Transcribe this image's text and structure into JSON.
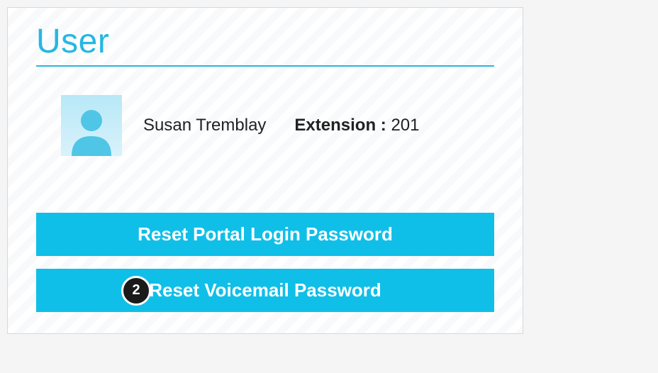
{
  "section": {
    "title": "User"
  },
  "user": {
    "name": "Susan Tremblay",
    "extension_label": "Extension :",
    "extension_value": "201"
  },
  "buttons": {
    "reset_portal": "Reset Portal Login Password",
    "reset_voicemail": "Reset Voicemail Password"
  },
  "annotations": {
    "step_badge": "2"
  }
}
